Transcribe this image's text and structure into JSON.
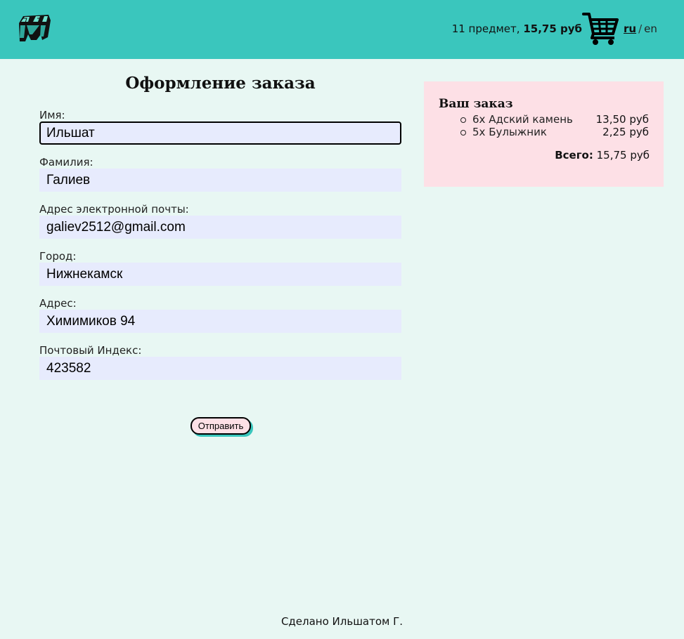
{
  "header": {
    "cart_count": "11 предмет,",
    "cart_sum": "15,75 руб",
    "lang_ru": "ru",
    "lang_sep": "/",
    "lang_en": "en"
  },
  "form": {
    "title": "Оформление заказа",
    "fields": [
      {
        "label": "Имя:",
        "value": "Ильшат"
      },
      {
        "label": "Фамилия:",
        "value": "Галиев"
      },
      {
        "label": "Адрес электронной почты:",
        "value": "galiev2512@gmail.com"
      },
      {
        "label": "Город:",
        "value": "Нижнекамск"
      },
      {
        "label": "Адрес:",
        "value": "Химимиков 94"
      },
      {
        "label": "Почтовый Индекс:",
        "value": "423582"
      }
    ],
    "submit_label": "Отправить"
  },
  "order": {
    "title": "Ваш заказ",
    "items": [
      {
        "name": "6x Адский камень",
        "price": "13,50 руб"
      },
      {
        "name": "5x Булыжник",
        "price": "2,25 руб"
      }
    ],
    "total_label": "Всего:",
    "total_value": "15,75 руб"
  },
  "footer": {
    "text": "Сделано Ильшатом Г."
  },
  "colors": {
    "header_bg": "#3ac6bd",
    "page_bg": "#e8f7f3",
    "input_bg": "#e7ebfd",
    "order_bg": "#fde0e6"
  },
  "icons": {
    "logo": "minecraft-logo-icon",
    "cart": "shopping-cart-icon"
  }
}
